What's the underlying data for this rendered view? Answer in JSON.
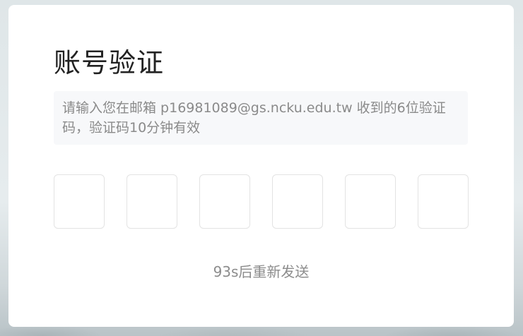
{
  "page": {
    "title": "账号验证",
    "notice": "请输入您在邮箱 p16981089@gs.ncku.edu.tw 收到的6位验证码，验证码10分钟有效",
    "code_boxes": [
      "",
      "",
      "",
      "",
      "",
      ""
    ],
    "resend_label": "93s后重新发送"
  },
  "colors": {
    "card_background": "#ffffff",
    "notice_background": "#f7f8fa",
    "muted_text": "#8a8a8a",
    "title_text": "#222222",
    "box_border": "#e3e3e3"
  }
}
